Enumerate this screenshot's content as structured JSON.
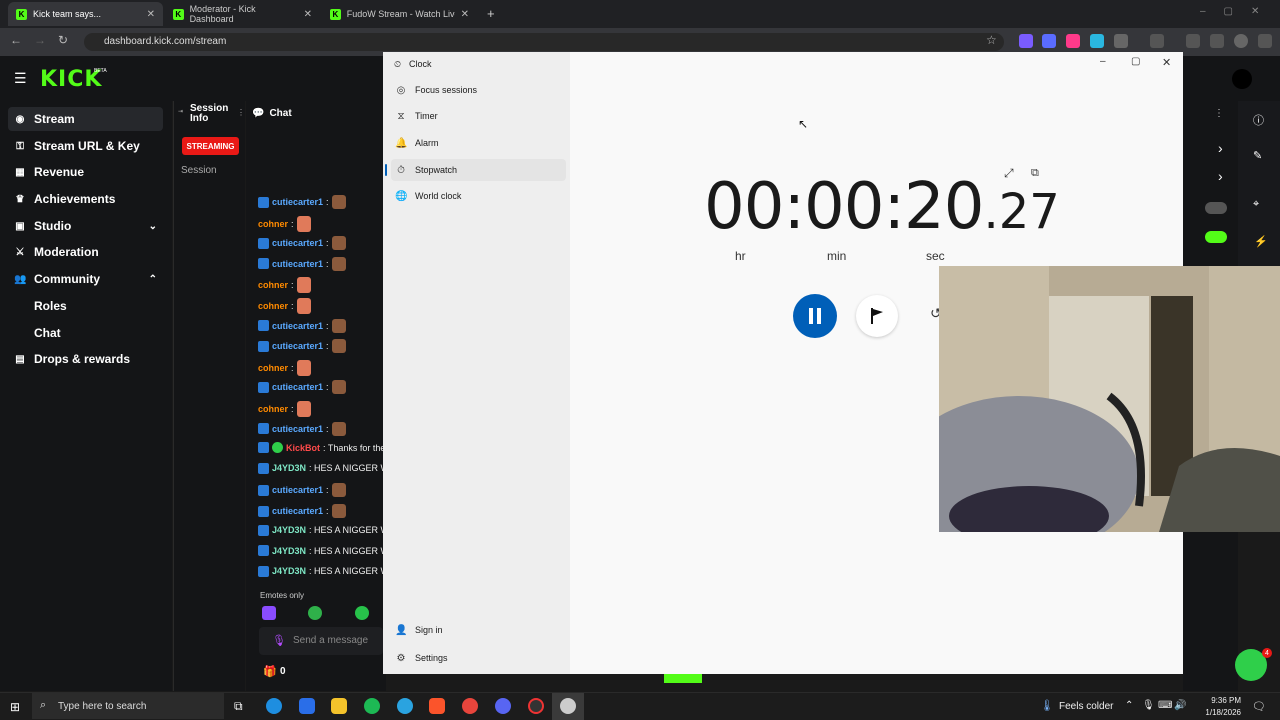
{
  "browser": {
    "tabs": [
      {
        "title": "Kick team says...",
        "active": true
      },
      {
        "title": "Moderator - Kick Dashboard",
        "active": false
      },
      {
        "title": "FudoW Stream - Watch Live on",
        "active": false
      }
    ],
    "url": "dashboard.kick.com/stream"
  },
  "kick": {
    "logo": "KICK",
    "beta": "BETA",
    "nav": [
      {
        "label": "Stream",
        "icon": "stream-icon",
        "active": true
      },
      {
        "label": "Stream URL & Key",
        "icon": "link-icon"
      },
      {
        "label": "Revenue",
        "icon": "revenue-icon"
      },
      {
        "label": "Achievements",
        "icon": "trophy-icon"
      },
      {
        "label": "Studio",
        "icon": "studio-icon"
      },
      {
        "label": "Moderation",
        "icon": "moderation-icon"
      },
      {
        "label": "Community",
        "icon": "community-icon"
      },
      {
        "label": "Roles",
        "icon": ""
      },
      {
        "label": "Chat",
        "icon": ""
      },
      {
        "label": "Drops & rewards",
        "icon": "drops-icon"
      }
    ],
    "session_info": "Session Info",
    "streaming_badge": "STREAMING",
    "session_label": "Session",
    "chat_title": "Chat",
    "chat_messages": [
      {
        "user": "cutiecarter1",
        "text": ":",
        "color": "#5aa9ff"
      },
      {
        "user": "cohner",
        "text": ":",
        "color": "#ff8a00"
      },
      {
        "user": "cutiecarter1",
        "text": ":",
        "color": "#5aa9ff"
      },
      {
        "user": "cutiecarter1",
        "text": ":",
        "color": "#5aa9ff"
      },
      {
        "user": "cohner",
        "text": ":",
        "color": "#ff8a00"
      },
      {
        "user": "cohner",
        "text": ":",
        "color": "#ff8a00"
      },
      {
        "user": "cutiecarter1",
        "text": ":",
        "color": "#5aa9ff"
      },
      {
        "user": "cutiecarter1",
        "text": ":",
        "color": "#5aa9ff"
      },
      {
        "user": "cohner",
        "text": ":",
        "color": "#ff8a00"
      },
      {
        "user": "cutiecarter1",
        "text": ":",
        "color": "#5aa9ff"
      },
      {
        "user": "cohner",
        "text": ":",
        "color": "#ff8a00"
      },
      {
        "user": "cutiecarter1",
        "text": ":",
        "color": "#5aa9ff"
      },
      {
        "user": "KickBot",
        "text": ": Thanks for the",
        "color": "#ff4a4a"
      },
      {
        "user": "J4YD3N",
        "text": ": HES A NIGGER W",
        "color": "#7fe8c6"
      },
      {
        "user": "cutiecarter1",
        "text": ":",
        "color": "#5aa9ff"
      },
      {
        "user": "cutiecarter1",
        "text": ":",
        "color": "#5aa9ff"
      },
      {
        "user": "J4YD3N",
        "text": ": HES A NIGGER W",
        "color": "#7fe8c6"
      },
      {
        "user": "J4YD3N",
        "text": ": HES A NIGGER W",
        "color": "#7fe8c6"
      },
      {
        "user": "J4YD3N",
        "text": ": HES A NIGGER W",
        "color": "#7fe8c6"
      }
    ],
    "emotes_only": "Emotes only",
    "send_placeholder": "Send a message",
    "gift_count": "0"
  },
  "clock": {
    "app_title": "Clock",
    "nav": [
      {
        "label": "Focus sessions",
        "icon": "focus-icon"
      },
      {
        "label": "Timer",
        "icon": "hourglass-icon"
      },
      {
        "label": "Alarm",
        "icon": "bell-icon"
      },
      {
        "label": "Stopwatch",
        "icon": "stopwatch-icon",
        "selected": true
      },
      {
        "label": "World clock",
        "icon": "globe-icon"
      }
    ],
    "sign_in": "Sign in",
    "settings": "Settings",
    "stopwatch": {
      "main": "00:00:20",
      "fraction": ".27",
      "hr": "hr",
      "min": "min",
      "sec": "sec"
    }
  },
  "taskbar": {
    "search_placeholder": "Type here to search",
    "weather": "Feels colder",
    "time": "9:36 PM",
    "date": "1/18/2026",
    "notif_count": "4"
  },
  "colors": {
    "kick_green": "#53fc18",
    "accent_blue": "#005fb8",
    "streaming_red": "#e91916"
  }
}
